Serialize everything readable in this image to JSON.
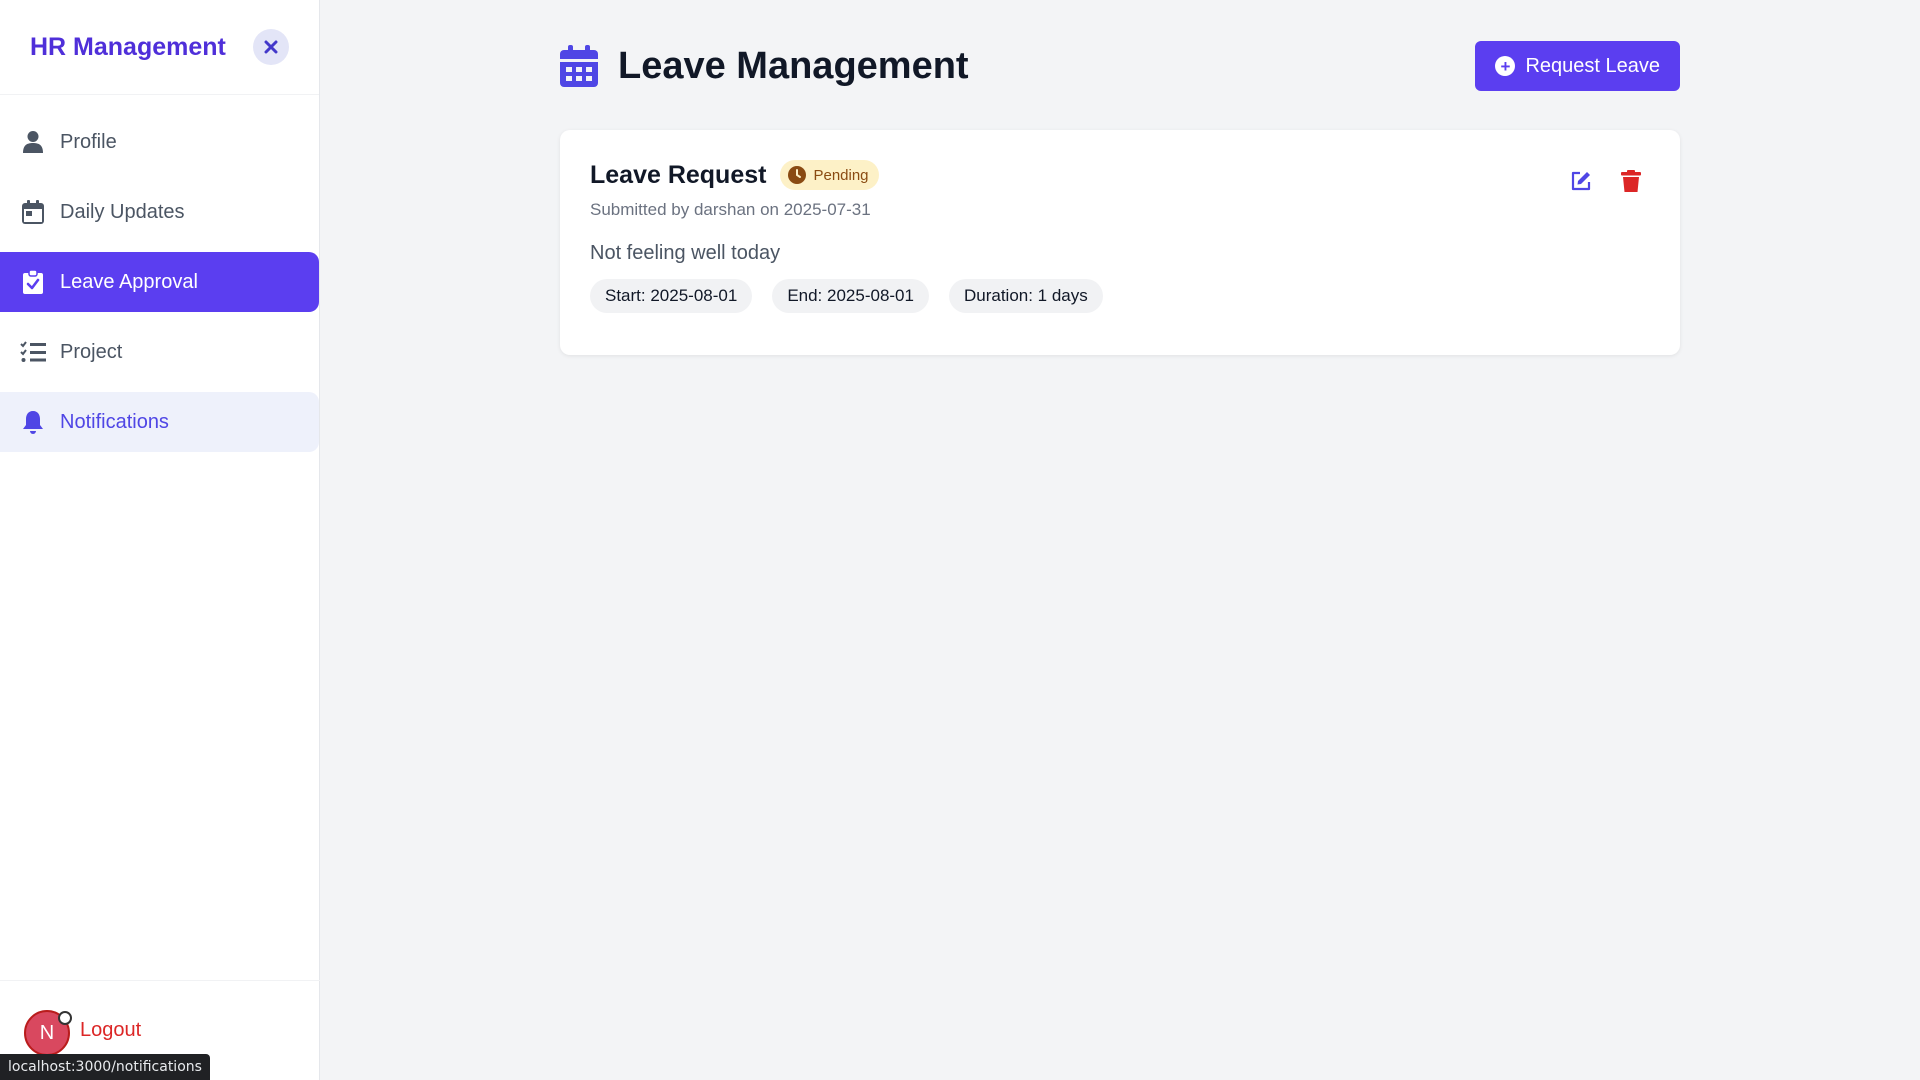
{
  "sidebar": {
    "brand": "HR Management",
    "items": [
      {
        "label": "Profile",
        "icon": "user-icon"
      },
      {
        "label": "Daily Updates",
        "icon": "calendar-icon"
      },
      {
        "label": "Leave Approval",
        "icon": "clipboard-check-icon",
        "state": "active"
      },
      {
        "label": "Project",
        "icon": "task-list-icon"
      },
      {
        "label": "Notifications",
        "icon": "bell-icon",
        "state": "hover"
      }
    ],
    "logout_label": "Logout",
    "avatar_initial": "N"
  },
  "status_bar": {
    "url": "localhost:3000/notifications"
  },
  "header": {
    "title": "Leave Management",
    "request_button": "Request Leave"
  },
  "leave_request": {
    "title": "Leave Request",
    "status": "Pending",
    "submitted": "Submitted by darshan on 2025-07-31",
    "reason": "Not feeling well today",
    "start": "Start: 2025-08-01",
    "end": "End: 2025-08-01",
    "duration": "Duration: 1 days"
  },
  "colors": {
    "accent": "#5b3ef0",
    "danger": "#dc2626",
    "pending_bg": "#fdf1c7"
  }
}
